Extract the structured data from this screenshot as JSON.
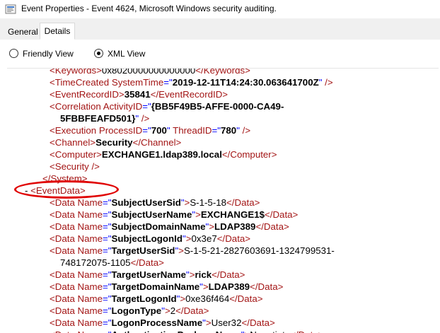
{
  "window": {
    "title": "Event Properties - Event 4624, Microsoft Windows security auditing."
  },
  "tabs": [
    {
      "label": "General"
    },
    {
      "label": "Details"
    }
  ],
  "view": {
    "friendly_label": "Friendly View",
    "xml_label": "XML View",
    "selected": "XML View"
  },
  "xml_lines": [
    {
      "indent": 3,
      "parts": [
        [
          "tag",
          "<Keywords>"
        ],
        [
          "val",
          "0x8020000000000000"
        ],
        [
          "tag",
          "</Keywords>"
        ]
      ]
    },
    {
      "indent": 3,
      "parts": [
        [
          "tag",
          "<TimeCreated "
        ],
        [
          "attr",
          "SystemTime"
        ],
        [
          "punct",
          "=\""
        ],
        [
          "bold",
          "2019-12-11T14:24:30.063641700Z"
        ],
        [
          "punct",
          "\""
        ],
        [
          "tag",
          " />"
        ]
      ]
    },
    {
      "indent": 3,
      "parts": [
        [
          "tag",
          "<EventRecordID>"
        ],
        [
          "bold",
          "35841"
        ],
        [
          "tag",
          "</EventRecordID>"
        ]
      ]
    },
    {
      "indent": 3,
      "parts": [
        [
          "tag",
          "<Correlation "
        ],
        [
          "attr",
          "ActivityID"
        ],
        [
          "punct",
          "=\""
        ],
        [
          "bold",
          "{BB5F49B5-AFFE-0000-CA49-"
        ]
      ]
    },
    {
      "indent": 4,
      "parts": [
        [
          "bold",
          "5FBBFEAFD501}"
        ],
        [
          "punct",
          "\""
        ],
        [
          "tag",
          " />"
        ]
      ]
    },
    {
      "indent": 3,
      "parts": [
        [
          "tag",
          "<Execution "
        ],
        [
          "attr",
          "ProcessID"
        ],
        [
          "punct",
          "=\""
        ],
        [
          "bold",
          "700"
        ],
        [
          "punct",
          "\""
        ],
        [
          "attr",
          " ThreadID"
        ],
        [
          "punct",
          "=\""
        ],
        [
          "bold",
          "780"
        ],
        [
          "punct",
          "\""
        ],
        [
          "tag",
          " />"
        ]
      ]
    },
    {
      "indent": 3,
      "parts": [
        [
          "tag",
          "<Channel>"
        ],
        [
          "bold",
          "Security"
        ],
        [
          "tag",
          "</Channel>"
        ]
      ]
    },
    {
      "indent": 3,
      "parts": [
        [
          "tag",
          "<Computer>"
        ],
        [
          "bold",
          "EXCHANGE1.ldap389.local"
        ],
        [
          "tag",
          "</Computer>"
        ]
      ]
    },
    {
      "indent": 3,
      "parts": [
        [
          "tag",
          "<Security />"
        ]
      ]
    },
    {
      "indent": 2,
      "parts": [
        [
          "tag",
          "</System>"
        ]
      ]
    },
    {
      "indent": 1,
      "parts": [
        [
          "minus",
          "- "
        ],
        [
          "tag",
          "<EventData>"
        ]
      ]
    },
    {
      "indent": 3,
      "parts": [
        [
          "tag",
          "<Data "
        ],
        [
          "attr",
          "Name"
        ],
        [
          "punct",
          "=\""
        ],
        [
          "bold",
          "SubjectUserSid"
        ],
        [
          "punct",
          "\""
        ],
        [
          "tag",
          ">"
        ],
        [
          "val",
          "S-1-5-18"
        ],
        [
          "tag",
          "</Data>"
        ]
      ]
    },
    {
      "indent": 3,
      "parts": [
        [
          "tag",
          "<Data "
        ],
        [
          "attr",
          "Name"
        ],
        [
          "punct",
          "=\""
        ],
        [
          "bold",
          "SubjectUserName"
        ],
        [
          "punct",
          "\""
        ],
        [
          "tag",
          ">"
        ],
        [
          "bold",
          "EXCHANGE1$"
        ],
        [
          "tag",
          "</Data>"
        ]
      ]
    },
    {
      "indent": 3,
      "parts": [
        [
          "tag",
          "<Data "
        ],
        [
          "attr",
          "Name"
        ],
        [
          "punct",
          "=\""
        ],
        [
          "bold",
          "SubjectDomainName"
        ],
        [
          "punct",
          "\""
        ],
        [
          "tag",
          ">"
        ],
        [
          "bold",
          "LDAP389"
        ],
        [
          "tag",
          "</Data>"
        ]
      ]
    },
    {
      "indent": 3,
      "parts": [
        [
          "tag",
          "<Data "
        ],
        [
          "attr",
          "Name"
        ],
        [
          "punct",
          "=\""
        ],
        [
          "bold",
          "SubjectLogonId"
        ],
        [
          "punct",
          "\""
        ],
        [
          "tag",
          ">"
        ],
        [
          "val",
          "0x3e7"
        ],
        [
          "tag",
          "</Data>"
        ]
      ]
    },
    {
      "indent": 3,
      "parts": [
        [
          "tag",
          "<Data "
        ],
        [
          "attr",
          "Name"
        ],
        [
          "punct",
          "=\""
        ],
        [
          "bold",
          "TargetUserSid"
        ],
        [
          "punct",
          "\""
        ],
        [
          "tag",
          ">"
        ],
        [
          "val",
          "S-1-5-21-2827603691-1324799531-"
        ]
      ]
    },
    {
      "indent": 4,
      "parts": [
        [
          "val",
          "748172075-1105"
        ],
        [
          "tag",
          "</Data>"
        ]
      ]
    },
    {
      "indent": 3,
      "parts": [
        [
          "tag",
          "<Data "
        ],
        [
          "attr",
          "Name"
        ],
        [
          "punct",
          "=\""
        ],
        [
          "bold",
          "TargetUserName"
        ],
        [
          "punct",
          "\""
        ],
        [
          "tag",
          ">"
        ],
        [
          "bold",
          "rick"
        ],
        [
          "tag",
          "</Data>"
        ]
      ]
    },
    {
      "indent": 3,
      "parts": [
        [
          "tag",
          "<Data "
        ],
        [
          "attr",
          "Name"
        ],
        [
          "punct",
          "=\""
        ],
        [
          "bold",
          "TargetDomainName"
        ],
        [
          "punct",
          "\""
        ],
        [
          "tag",
          ">"
        ],
        [
          "bold",
          "LDAP389"
        ],
        [
          "tag",
          "</Data>"
        ]
      ]
    },
    {
      "indent": 3,
      "parts": [
        [
          "tag",
          "<Data "
        ],
        [
          "attr",
          "Name"
        ],
        [
          "punct",
          "=\""
        ],
        [
          "bold",
          "TargetLogonId"
        ],
        [
          "punct",
          "\""
        ],
        [
          "tag",
          ">"
        ],
        [
          "val",
          "0xe36f464"
        ],
        [
          "tag",
          "</Data>"
        ]
      ]
    },
    {
      "indent": 3,
      "parts": [
        [
          "tag",
          "<Data "
        ],
        [
          "attr",
          "Name"
        ],
        [
          "punct",
          "=\""
        ],
        [
          "bold",
          "LogonType"
        ],
        [
          "punct",
          "\""
        ],
        [
          "tag",
          ">"
        ],
        [
          "val",
          "2"
        ],
        [
          "tag",
          "</Data>"
        ]
      ]
    },
    {
      "indent": 3,
      "parts": [
        [
          "tag",
          "<Data "
        ],
        [
          "attr",
          "Name"
        ],
        [
          "punct",
          "=\""
        ],
        [
          "bold",
          "LogonProcessName"
        ],
        [
          "punct",
          "\""
        ],
        [
          "tag",
          ">"
        ],
        [
          "val",
          "User32"
        ],
        [
          "tag",
          "</Data>"
        ]
      ]
    },
    {
      "indent": 3,
      "parts": [
        [
          "tag",
          "<Data "
        ],
        [
          "attr",
          "Name"
        ],
        [
          "punct",
          "=\""
        ],
        [
          "bold",
          "AuthenticationPackageName"
        ],
        [
          "punct",
          "\""
        ],
        [
          "tag",
          ">"
        ],
        [
          "val",
          "Negotiate"
        ],
        [
          "tag",
          "</Data>"
        ]
      ]
    }
  ],
  "colors": {
    "tag": "#a31515",
    "punct": "#0000ff",
    "annotation": "#e00000"
  }
}
